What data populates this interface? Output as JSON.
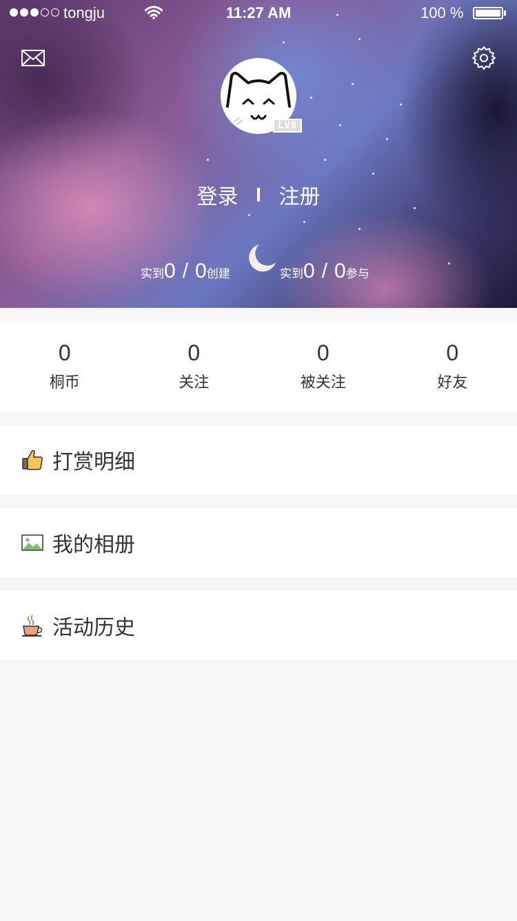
{
  "status_bar": {
    "carrier": "tongju",
    "time": "11:27 AM",
    "battery": "100 %"
  },
  "profile": {
    "level": "LV0",
    "login": "登录",
    "register": "注册"
  },
  "activity_stats": {
    "left": {
      "label": "实到",
      "value1": "0",
      "slash": "/",
      "value2": "0",
      "suffix": "创建"
    },
    "right": {
      "label": "实到",
      "value1": "0",
      "slash": "/",
      "value2": "0",
      "suffix": "参与"
    }
  },
  "counts": [
    {
      "value": "0",
      "label": "桐币"
    },
    {
      "value": "0",
      "label": "关注"
    },
    {
      "value": "0",
      "label": "被关注"
    },
    {
      "value": "0",
      "label": "好友"
    }
  ],
  "menu": [
    {
      "label": "打赏明细",
      "icon": "thumbs-up-icon"
    },
    {
      "label": "我的相册",
      "icon": "photo-icon"
    },
    {
      "label": "活动历史",
      "icon": "coffee-cup-icon"
    }
  ]
}
